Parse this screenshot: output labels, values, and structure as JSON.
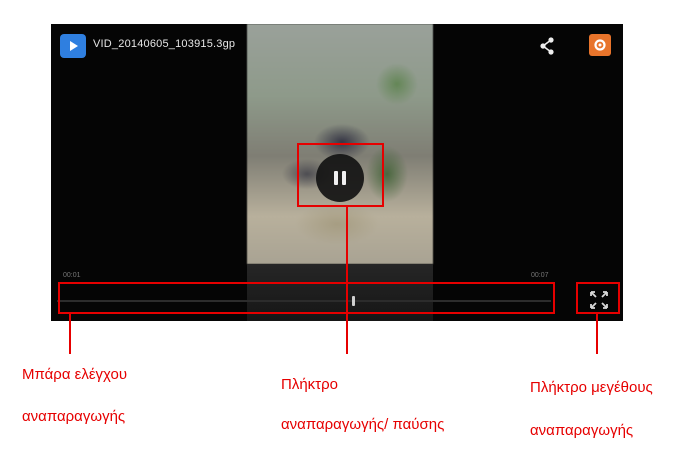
{
  "player": {
    "file_name": "VID_20140605_103915.3gp",
    "time_current": "00:01",
    "time_total": "00:07",
    "progress_fraction": 0.6
  },
  "icons": {
    "app": "play-icon",
    "share": "share-icon",
    "settings": "settings-icon",
    "pause": "pause-icon",
    "fullscreen": "fullscreen-icon"
  },
  "captions": {
    "control_bar_line1": "Μπάρα ελέγχου",
    "control_bar_line2": "αναπαραγωγής",
    "pause_key_line1": "Πλήκτρο",
    "pause_key_line2": "αναπαραγωγής/ παύσης",
    "size_key_line1": "Πλήκτρο μεγέθους",
    "size_key_line2": "αναπαραγωγής"
  },
  "colors": {
    "annotation": "#e60000",
    "settings_accent": "#e8742b",
    "app_icon": "#2f7fe0"
  }
}
